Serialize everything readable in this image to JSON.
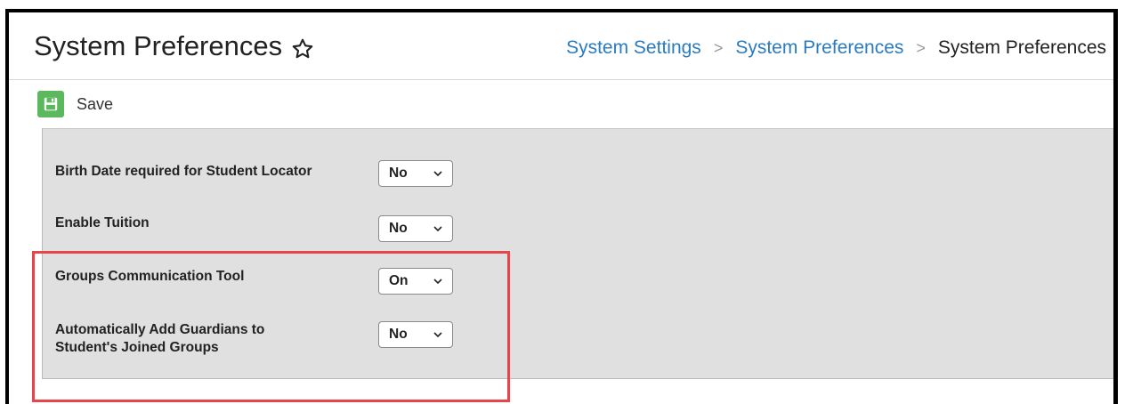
{
  "header": {
    "title": "System Preferences",
    "star_icon": "star-outline-icon"
  },
  "breadcrumb": {
    "items": [
      "System Settings",
      "System Preferences",
      "System Preferences"
    ],
    "separator": ">"
  },
  "toolbar": {
    "save_label": "Save",
    "save_icon": "floppy-disk-icon",
    "save_icon_color": "#5cb85c"
  },
  "preferences": [
    {
      "label": "Birth Date required for Student Locator",
      "value": "No"
    },
    {
      "label": "Enable Tuition",
      "value": "No"
    },
    {
      "label": "Groups Communication Tool",
      "value": "On"
    },
    {
      "label": "Automatically Add Guardians to\nStudent's Joined Groups",
      "value": "No"
    }
  ],
  "colors": {
    "link": "#2a7bc0",
    "highlight": "#e8454a",
    "panel_bg": "#e0e0e0"
  }
}
